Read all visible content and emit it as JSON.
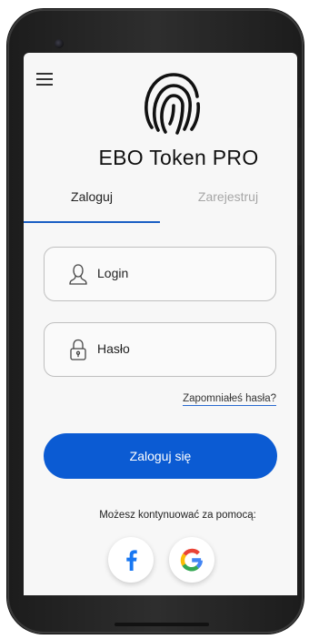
{
  "app": {
    "title": "EBO Token PRO"
  },
  "header": {
    "menu_icon": "hamburger-menu-icon",
    "logo_icon": "fingerprint-icon"
  },
  "tabs": [
    {
      "label": "Zaloguj",
      "active": true
    },
    {
      "label": "Zarejestruj",
      "active": false
    }
  ],
  "form": {
    "login": {
      "placeholder": "Login",
      "icon": "user-icon"
    },
    "password": {
      "placeholder": "Hasło",
      "icon": "lock-icon"
    },
    "forgot_label": "Zapomniałeś hasła?",
    "submit_label": "Zaloguj się"
  },
  "social": {
    "label": "Możesz kontynuować za pomocą:",
    "providers": [
      {
        "name": "facebook",
        "icon": "facebook-icon",
        "color": "#1877f2"
      },
      {
        "name": "google",
        "icon": "google-icon"
      }
    ]
  },
  "colors": {
    "accent": "#0b5bd3",
    "inactive_tab": "#a6a6a6"
  }
}
